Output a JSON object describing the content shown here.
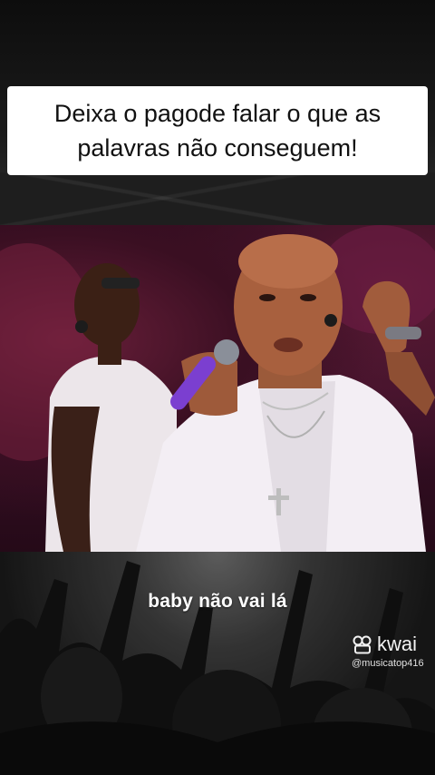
{
  "caption": {
    "text": "Deixa o pagode falar o que as palavras não conseguem!"
  },
  "lyric": {
    "text": "baby não vai lá"
  },
  "watermark": {
    "brand": "kwai",
    "handle": "@musicatop416"
  },
  "icons": {
    "watermark_icon": "kwai-logo-icon"
  },
  "colors": {
    "caption_background": "#ffffff",
    "caption_text": "#111111",
    "stage_light": "#7a1f4a",
    "shirt": "#f3eef4",
    "microphone": "#7b3fd0"
  }
}
